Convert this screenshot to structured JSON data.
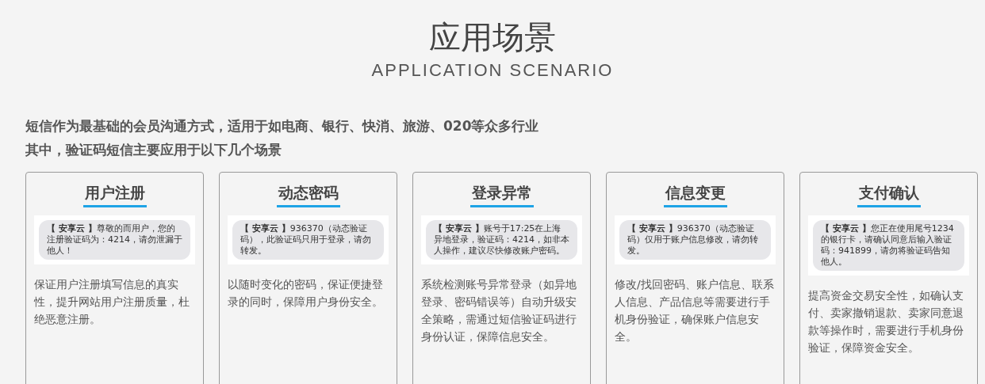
{
  "header": {
    "title": "应用场景",
    "subtitle": "APPLICATION SCENARIO"
  },
  "intro": [
    "短信作为最基础的会员沟通方式，适用于如电商、银行、快消、旅游、020等众多行业",
    "其中，验证码短信主要应用于以下几个场景"
  ],
  "cards": [
    {
      "title": "用户注册",
      "sms": "**【 安享云 】**尊敬的而用户，您的注册验证码为：4214，请勿泄漏于他人！",
      "description": "保证用户注册填写信息的真实性，提升网站用户注册质量，杜绝恶意注册。"
    },
    {
      "title": "动态密码",
      "sms": "**【 安享云 】**936370（动态验证码），此验证码只用于登录，请勿转发。",
      "description": "以随时变化的密码，保证便捷登录的同时，保障用户身份安全。"
    },
    {
      "title": "登录异常",
      "sms": "**【 安享云 】**账号于17:25在上海异地登录，验证码：4214，如非本人操作，建议尽快修改账户密码。",
      "description": "系统检测账号异常登录（如异地登录、密码错误等）自动升级安全策略，需通过短信验证码进行身份认证，保障信息安全。"
    },
    {
      "title": "信息变更",
      "sms": "**【 安享云 】**936370（动态验证码）仅用于账户信息修改，请勿转发。",
      "description": "修改/找回密码、账户信息、联系人信息、产品信息等需要进行手机身份验证，确保账户信息安全。"
    },
    {
      "title": "支付确认",
      "sms": "**【 安享云 】**您正在使用尾号1234的银行卡，请确认同意后输入验证码：941899，请勿将验证码告知他人。",
      "description": "提高资金交易安全性，如确认支付、卖家撤销退款、卖家同意退款等操作时，需要进行手机身份验证，保障资金安全。"
    }
  ]
}
